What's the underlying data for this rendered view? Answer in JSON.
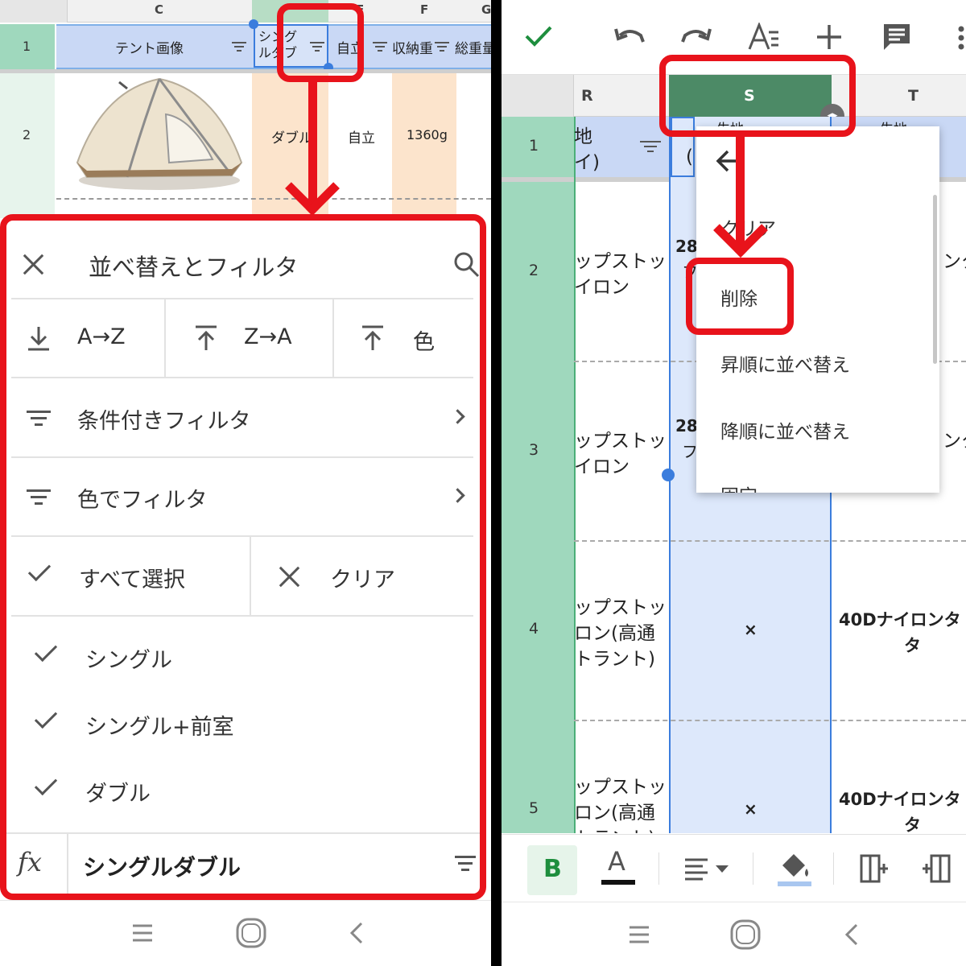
{
  "colors": {
    "accent_red": "#e8131b",
    "sheet_green": "#4c8a66",
    "row_header_green": "#9fd8bd",
    "header_blue": "#c9d8f5",
    "peach": "#fce4cc",
    "check_green": "#1e8e3e"
  },
  "left": {
    "columns": [
      "C",
      "E",
      "F",
      "G"
    ],
    "header_cells": [
      "テント画像",
      "シングルダブ",
      "自立",
      "収納重量",
      "総重量"
    ],
    "header_cell_wrapped": [
      "シング",
      "ルダブ"
    ],
    "rows": [
      "1",
      "2"
    ],
    "row2": {
      "image_name": "tent-image",
      "cell_d": "ダブル",
      "cell_e": "自立",
      "cell_f": "1360g"
    },
    "sheet": {
      "title": "並べ替えとフィルタ",
      "close_icon": "close-icon",
      "search_icon": "search-icon",
      "sort_asc": "A→Z",
      "sort_desc": "Z→A",
      "sort_color": "色",
      "condition_filter": "条件付きフィルタ",
      "color_filter": "色でフィルタ",
      "select_all": "すべて選択",
      "clear": "クリア",
      "values": [
        "シングル",
        "シングル+前室",
        "ダブル"
      ],
      "formula_icon": "fx",
      "formula_value": "シングルダブル"
    }
  },
  "right": {
    "toolbar_icons": [
      "check-icon",
      "undo-icon",
      "redo-icon",
      "text-format-icon",
      "add-icon",
      "comment-icon",
      "more-icon"
    ],
    "columns": [
      "R",
      "S",
      "T"
    ],
    "rows": [
      "1",
      "2",
      "3",
      "4",
      "5"
    ],
    "col_r": {
      "r1": [
        "地",
        "イ)"
      ],
      "r2": [
        "ップストッ",
        "イロン"
      ],
      "r3": [
        "ップストッ",
        "イロン"
      ],
      "r4": [
        "ップストッ",
        "ロン(高通",
        "トラント)"
      ],
      "r5": [
        "ップストッ",
        "ロン(高通",
        "トラント)"
      ]
    },
    "col_s": {
      "r1": "生地",
      "r1b": "(",
      "r2": "28",
      "r2b": "フ",
      "r3": "28",
      "r3b": "フ",
      "r4": "×",
      "r5": "×"
    },
    "col_t": {
      "r1": "生地",
      "r2": "ンタ",
      "r3": "ンタ",
      "r4": [
        "40Dナイロンタ",
        "タ"
      ],
      "r5": [
        "40Dナイロンタ",
        "タ"
      ]
    },
    "context_menu": {
      "back_icon": "arrow-back-icon",
      "items": [
        "クリア",
        "削除",
        "昇順に並べ替え",
        "降順に並べ替え",
        "固定"
      ]
    },
    "bottom_toolbar_icons": [
      "bold-icon",
      "text-color-icon",
      "align-icon",
      "fill-color-icon",
      "insert-column-left-icon",
      "insert-column-right-icon"
    ],
    "bold_label": "B",
    "text_color_label": "A"
  },
  "nav_icons": [
    "menu-icon",
    "home-icon",
    "back-icon"
  ]
}
